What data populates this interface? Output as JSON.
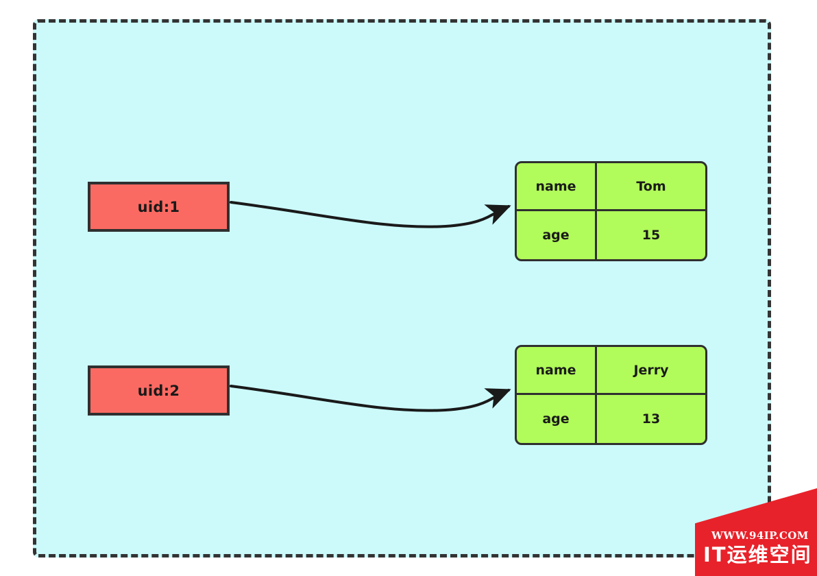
{
  "diagram": {
    "title": "redis-hash-structure",
    "background_color": "#ccfafb",
    "border_color": "#333333",
    "key_color": "#fb6a62",
    "hash_color": "#b1fb5a",
    "arrow_color": "#1a1a1a",
    "keys": [
      {
        "label": "uid:1"
      },
      {
        "label": "uid:2"
      }
    ],
    "hashes": [
      {
        "rows": [
          {
            "field": "name",
            "value": "Tom"
          },
          {
            "field": "age",
            "value": "15"
          }
        ]
      },
      {
        "rows": [
          {
            "field": "name",
            "value": "Jerry"
          },
          {
            "field": "age",
            "value": "13"
          }
        ]
      }
    ]
  },
  "watermark": {
    "url": "WWW.94IP.COM",
    "name": "IT运维空间",
    "color": "#e8222a"
  }
}
